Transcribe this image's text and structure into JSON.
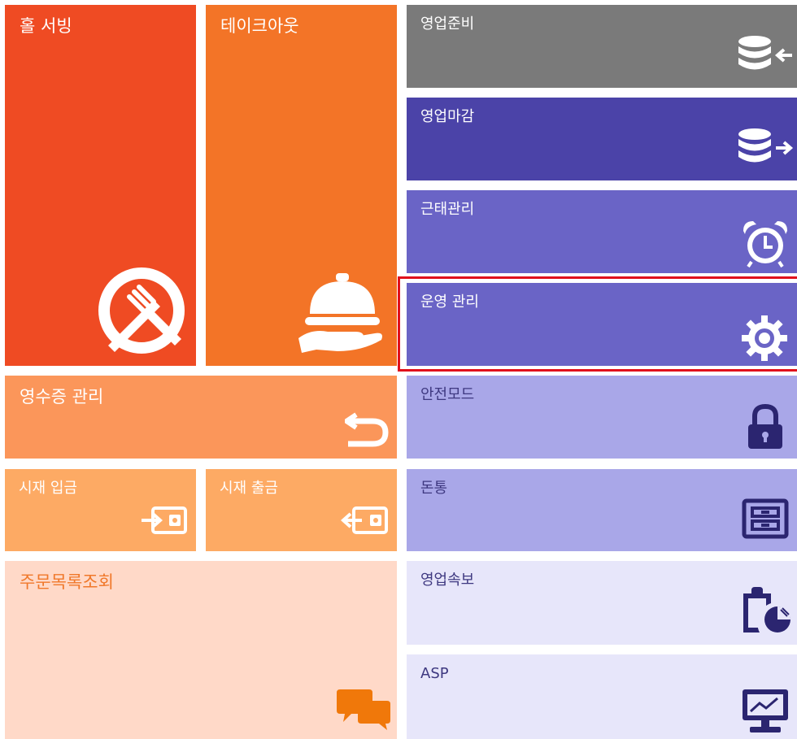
{
  "colors": {
    "hall": "#EF4B23",
    "takeout": "#F37427",
    "receipt": "#FB965A",
    "cash": "#FDAA64",
    "orders": "#FFD9C8",
    "prep": "#7A7A7A",
    "close": "#4B43A8",
    "mid_purple": "#6A64C6",
    "light_purple": "#A9A7E8",
    "pale_purple": "#E7E6FA",
    "selection": "#E0101B"
  },
  "tiles": {
    "hall_serving": {
      "label": "홀 서빙",
      "icon": "plate-fork-knife-icon"
    },
    "takeout": {
      "label": "테이크아웃",
      "icon": "serving-cloche-icon"
    },
    "receipt_mgmt": {
      "label": "영수증 관리",
      "icon": "return-arrow-icon"
    },
    "cash_in": {
      "label": "시재 입금",
      "icon": "wallet-in-icon"
    },
    "cash_out": {
      "label": "시재 출금",
      "icon": "wallet-out-icon"
    },
    "order_list": {
      "label": "주문목록조회",
      "icon": "chat-bubbles-icon"
    },
    "business_prep": {
      "label": "영업준비",
      "icon": "database-in-icon"
    },
    "business_close": {
      "label": "영업마감",
      "icon": "database-out-icon"
    },
    "attendance": {
      "label": "근태관리",
      "icon": "alarm-clock-icon"
    },
    "operations": {
      "label": "운영 관리",
      "icon": "gear-icon",
      "selected": true
    },
    "safe_mode": {
      "label": "안전모드",
      "icon": "padlock-icon"
    },
    "cash_drawer": {
      "label": "돈통",
      "icon": "cash-drawer-icon"
    },
    "sales_report": {
      "label": "영업속보",
      "icon": "clipboard-pie-icon"
    },
    "asp": {
      "label": "ASP",
      "icon": "monitor-chart-icon"
    }
  }
}
